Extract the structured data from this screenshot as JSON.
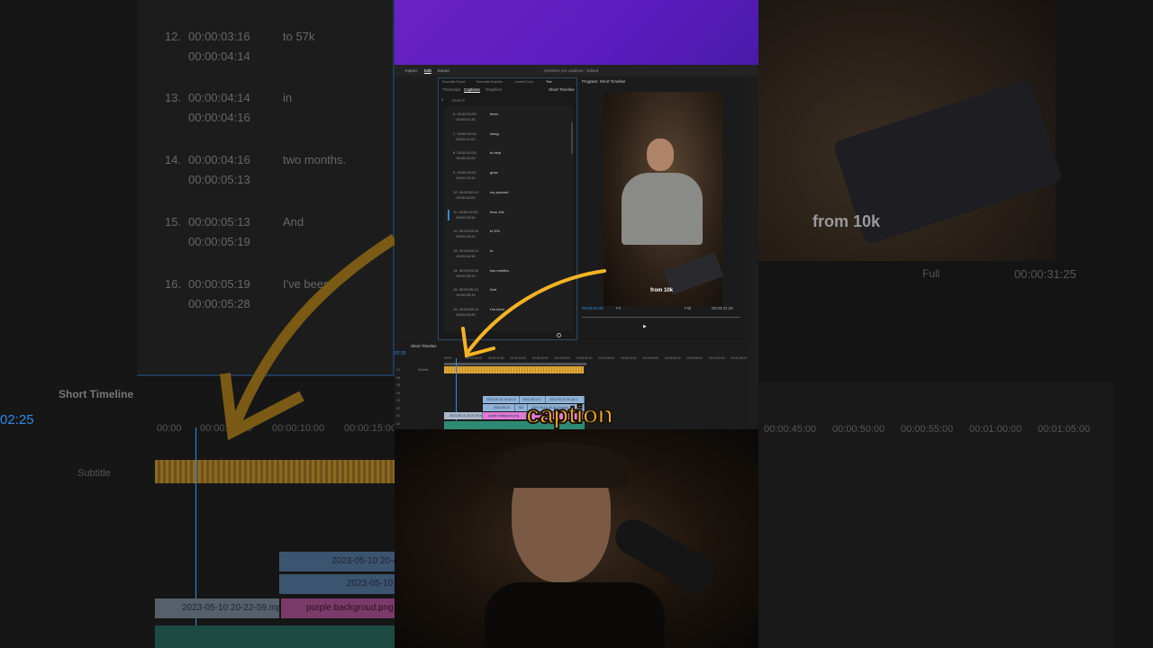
{
  "app": {
    "menu": [
      "Import",
      "Edit",
      "Export"
    ],
    "title": "premiere pro captions - Edited"
  },
  "text_panel": {
    "tabs_top": [
      "Essential Sound",
      "Essential Graphics",
      "Lumetri Color",
      "Text"
    ],
    "tabs": [
      "Transcript",
      "Captions",
      "Graphics"
    ],
    "sequence": "Short Timeline",
    "search_placeholder": "Search",
    "captions": [
      {
        "n": "6.",
        "in": "00:00:01:09",
        "out": "00:00:01:15",
        "text": "been"
      },
      {
        "n": "7.",
        "in": "00:00:01:15",
        "out": "00:00:01:24",
        "text": "using"
      },
      {
        "n": "8.",
        "in": "00:00:01:24",
        "out": "00:00:02:03",
        "text": "to help"
      },
      {
        "n": "9.",
        "in": "00:00:02:03",
        "out": "00:00:02:10",
        "text": "grow"
      },
      {
        "n": "10.",
        "in": "00:00:02:10",
        "out": "00:00:02:25",
        "text": "my account"
      },
      {
        "n": "11.",
        "in": "00:00:02:25",
        "out": "00:00:03:16",
        "text": "from 10k"
      },
      {
        "n": "12.",
        "in": "00:00:03:16",
        "out": "00:00:04:14",
        "text": "to 57k"
      },
      {
        "n": "13.",
        "in": "00:00:04:14",
        "out": "00:00:04:16",
        "text": "in"
      },
      {
        "n": "14.",
        "in": "00:00:04:16",
        "out": "00:00:05:13",
        "text": "two months."
      },
      {
        "n": "15.",
        "in": "00:00:05:13",
        "out": "00:00:05:19",
        "text": "And"
      },
      {
        "n": "16.",
        "in": "00:00:05:19",
        "out": "00:00:05:28",
        "text": "I've been"
      }
    ]
  },
  "program": {
    "title": "Program: Short Timeline",
    "caption_overlay": "from 10k",
    "timecode": "00:00:02:25",
    "fit": "Fit",
    "quality": "Full",
    "duration": "00:00:31:25"
  },
  "timeline": {
    "title": "Short Timeline",
    "timecode": "02:25",
    "ruler": [
      "00:00",
      "00:00:05:00",
      "00:00:10:00",
      "00:00:15:00",
      "00:00:20:00",
      "00:00:25:00",
      "00:00:30:00",
      "00:00:35:00",
      "00:00:40:00",
      "00:00:45:00",
      "00:00:50:00",
      "00:00:55:00",
      "00:01:00:00",
      "00:01:05:00"
    ],
    "tracks": [
      "C1",
      "V6",
      "V5",
      "V4",
      "V3",
      "V2",
      "V1",
      "A1"
    ],
    "subtitle_label": "Subtitle",
    "clips": {
      "v4a": "2023-05-10 20-42-12",
      "v4b": "2023-05-10 2",
      "v4c": "2023-05-10 20-40-1",
      "v3a": "2023-05-10",
      "v3b": "202",
      "v3c": "2023-05-10 20-21-54.mp4",
      "v1a": "2023-05-10 20-22-59.mp4",
      "v1b": "purple backgroud.png"
    }
  },
  "overlay_caption": "caption",
  "colors": {
    "accent": "#2d8ceb",
    "caption_yellow": "#f5b324",
    "purple": "#5a1cbf"
  }
}
